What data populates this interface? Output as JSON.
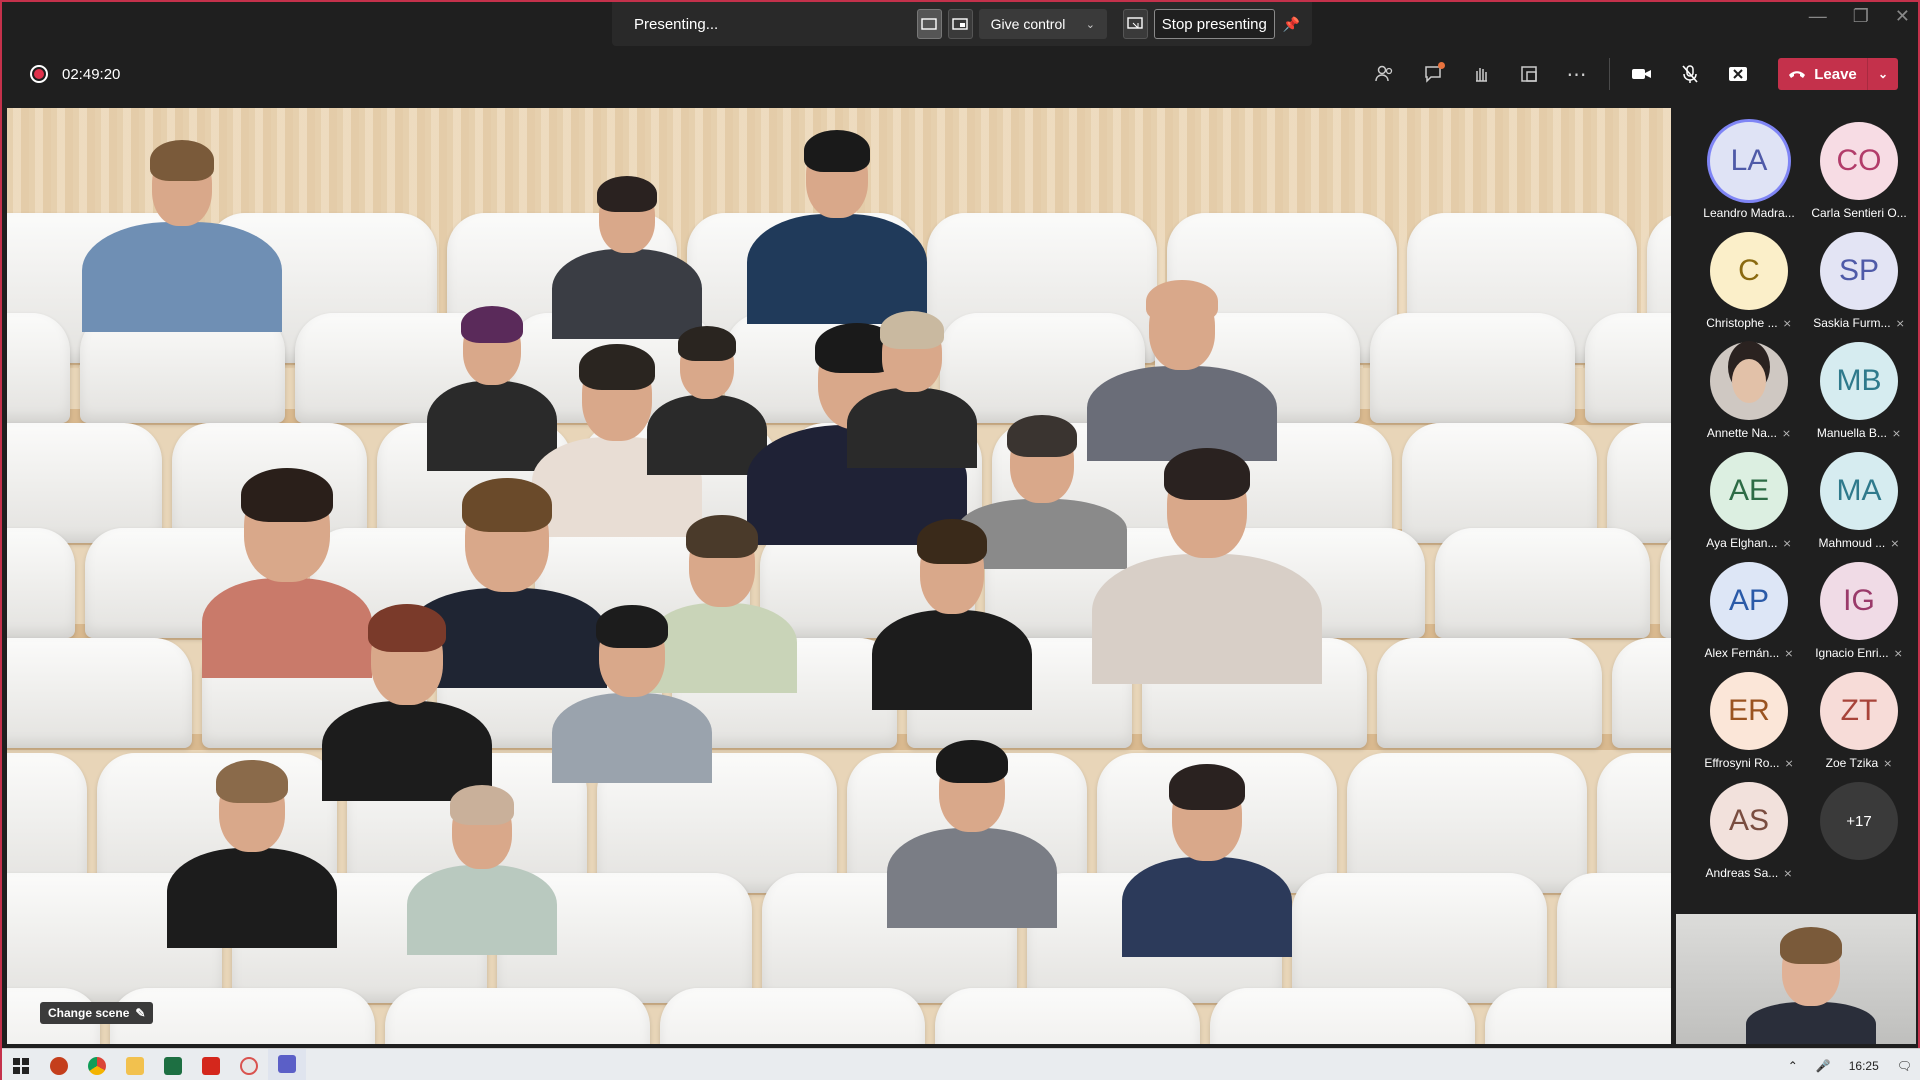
{
  "presenting": {
    "status": "Presenting...",
    "give_control": "Give control",
    "stop_presenting": "Stop presenting"
  },
  "meeting": {
    "timer": "02:49:20",
    "leave_label": "Leave"
  },
  "stage": {
    "change_scene": "Change scene"
  },
  "roster": [
    {
      "initials": "LA",
      "name": "Leandro Madra...",
      "color": "#dfe3f5",
      "text": "#4f5aa8",
      "muted": false,
      "selected": true
    },
    {
      "initials": "CO",
      "name": "Carla Sentieri O...",
      "color": "#f7dce4",
      "text": "#b23c6a",
      "muted": false
    },
    {
      "initials": "C",
      "name": "Christophe ...",
      "color": "#fbefc9",
      "text": "#8a6a10",
      "muted": true
    },
    {
      "initials": "SP",
      "name": "Saskia Furm...",
      "color": "#e3e4f4",
      "text": "#4f5aa8",
      "muted": true
    },
    {
      "initials": "",
      "name": "Annette Na...",
      "color": "#cfc8c2",
      "text": "#333",
      "muted": true,
      "photo": true
    },
    {
      "initials": "MB",
      "name": "Manuella B...",
      "color": "#d6ecf0",
      "text": "#2f7a8c",
      "muted": true
    },
    {
      "initials": "AE",
      "name": "Aya Elghan...",
      "color": "#dcefe1",
      "text": "#2d6b45",
      "muted": true
    },
    {
      "initials": "MA",
      "name": "Mahmoud ...",
      "color": "#d6ecf0",
      "text": "#2f7a8c",
      "muted": true
    },
    {
      "initials": "AP",
      "name": "Alex Fernán...",
      "color": "#dde6f6",
      "text": "#2a5aa8",
      "muted": true
    },
    {
      "initials": "IG",
      "name": "Ignacio Enri...",
      "color": "#f0dbe6",
      "text": "#9a3a6a",
      "muted": true
    },
    {
      "initials": "ER",
      "name": "Effrosyni Ro...",
      "color": "#fbe6d8",
      "text": "#9a5320",
      "muted": true
    },
    {
      "initials": "ZT",
      "name": "Zoe Tzika",
      "color": "#f7dcd8",
      "text": "#a8443a",
      "muted": true
    },
    {
      "initials": "AS",
      "name": "Andreas Sa...",
      "color": "#f2e1dc",
      "text": "#7a4d40",
      "muted": true
    },
    {
      "initials": "+17",
      "name": "",
      "color": "#3a3a3a",
      "text": "#ffffff",
      "muted": false,
      "overflow": true
    }
  ],
  "taskbar": {
    "time": "16:25"
  }
}
